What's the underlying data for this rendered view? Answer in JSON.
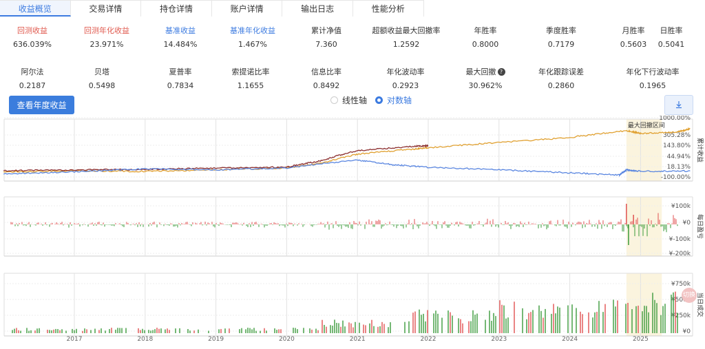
{
  "tabs": [
    {
      "label": "收益概览",
      "active": true
    },
    {
      "label": "交易详情",
      "active": false
    },
    {
      "label": "持仓详情",
      "active": false
    },
    {
      "label": "账户详情",
      "active": false
    },
    {
      "label": "输出日志",
      "active": false
    },
    {
      "label": "性能分析",
      "active": false
    }
  ],
  "metrics_row1": [
    {
      "label": "回测收益",
      "value": "636.039%",
      "color": "red"
    },
    {
      "label": "回测年化收益",
      "value": "23.971%",
      "color": "red"
    },
    {
      "label": "基准收益",
      "value": "14.484%",
      "color": "blue"
    },
    {
      "label": "基准年化收益",
      "value": "1.467%",
      "color": "blue"
    },
    {
      "label": "累计净值",
      "value": "7.360",
      "color": ""
    },
    {
      "label": "超额收益最大回撤率",
      "value": "1.2592",
      "color": ""
    },
    {
      "label": "年胜率",
      "value": "0.8000",
      "color": ""
    },
    {
      "label": "季度胜率",
      "value": "0.7179",
      "color": ""
    },
    {
      "label": "月胜率",
      "value": "0.5603",
      "color": ""
    },
    {
      "label": "日胜率",
      "value": "0.5041",
      "color": ""
    }
  ],
  "metrics_row2": [
    {
      "label": "阿尔法",
      "value": "0.2187",
      "help": false
    },
    {
      "label": "贝塔",
      "value": "0.5498",
      "help": false
    },
    {
      "label": "夏普率",
      "value": "0.7834",
      "help": false
    },
    {
      "label": "索提诺比率",
      "value": "1.1655",
      "help": false
    },
    {
      "label": "信息比率",
      "value": "0.8492",
      "help": false
    },
    {
      "label": "年化波动率",
      "value": "0.2923",
      "help": false
    },
    {
      "label": "最大回撤",
      "value": "30.962%",
      "help": true
    },
    {
      "label": "年化跟踪误差",
      "value": "0.2860",
      "help": false
    },
    {
      "label": "年化下行波动率",
      "value": "0.1965",
      "help": false
    }
  ],
  "year_button": "查看年度收益",
  "axis_toggle": {
    "linear": "线性轴",
    "log": "对数轴",
    "selected": "log"
  },
  "download_icon": "download-icon",
  "help_glyph": "?",
  "float_icon_text": "切换",
  "colors": {
    "strategy": "#e0a030",
    "strategy_dark": "#8b2e2e",
    "benchmark": "#5a86e0",
    "gain": "#e05050",
    "loss": "#3a9a3a",
    "drawdown": "#fbf4de"
  },
  "chart_data": {
    "type": "line",
    "x_ticks": [
      "2017",
      "2018",
      "2019",
      "2020",
      "2021",
      "2022",
      "2023",
      "2024",
      "2025"
    ],
    "panels": [
      {
        "name": "cumulative",
        "ylabel": "累计收益",
        "y_ticks": [
          "1000.00%",
          "305.28%",
          "143.80%",
          "44.94%",
          "18.13%",
          "-100.00%"
        ],
        "annotation": "最大回撤区间",
        "series": [
          {
            "key": "strategy",
            "x": [
              2016.0,
              2017.0,
              2018.0,
              2019.0,
              2020.0,
              2020.5,
              2021.0,
              2021.8,
              2022.0,
              2023.0,
              2024.0,
              2024.8,
              2025.0,
              2025.5,
              2025.7
            ],
            "y": [
              0.1,
              0.15,
              0.12,
              0.2,
              0.3,
              0.6,
              1.4,
              2.0,
              2.2,
              3.0,
              4.0,
              5.8,
              5.0,
              5.3,
              6.36
            ]
          },
          {
            "key": "strategy_dark",
            "x": [
              2016.0,
              2017.0,
              2018.0,
              2019.0,
              2020.0,
              2020.5,
              2021.0,
              2021.8,
              2022.0
            ],
            "y": [
              0.15,
              0.2,
              0.22,
              0.3,
              0.35,
              0.8,
              1.8,
              2.4,
              2.5
            ]
          },
          {
            "key": "benchmark",
            "x": [
              2016.0,
              2017.0,
              2018.0,
              2019.0,
              2020.0,
              2021.0,
              2021.5,
              2022.0,
              2023.0,
              2024.0,
              2024.7,
              2024.8,
              2025.0,
              2025.7
            ],
            "y": [
              0.0,
              0.1,
              0.25,
              0.2,
              0.3,
              0.85,
              0.5,
              0.35,
              0.2,
              0.05,
              -0.05,
              0.2,
              0.12,
              0.14
            ]
          }
        ]
      },
      {
        "name": "daily",
        "ylabel": "每日盈亏",
        "y_ticks": [
          "¥100k",
          "¥0",
          "¥-100k",
          "¥-200k"
        ]
      },
      {
        "name": "volume",
        "ylabel": "当日成交",
        "y_ticks": [
          "¥750k",
          "¥500k",
          "¥250k",
          "¥0"
        ]
      }
    ],
    "drawdown_range": [
      2024.8,
      2025.3
    ]
  }
}
